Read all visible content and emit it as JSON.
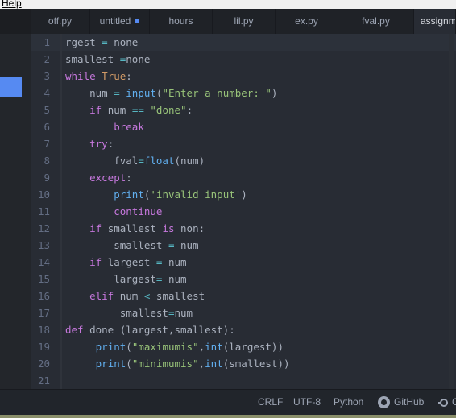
{
  "menu": {
    "help_label": "Help"
  },
  "tabs": [
    {
      "label": "off.py",
      "modified": false
    },
    {
      "label": "untitled",
      "modified": true
    },
    {
      "label": "hours",
      "modified": false
    },
    {
      "label": "lil.py",
      "modified": false
    },
    {
      "label": "ex.py",
      "modified": false
    },
    {
      "label": "fval.py",
      "modified": false
    },
    {
      "label": "assignm",
      "modified": false
    }
  ],
  "editor": {
    "lines": [
      {
        "n": "1",
        "code": "rgest = none"
      },
      {
        "n": "2",
        "code": "smallest =none"
      },
      {
        "n": "3",
        "code": "while True:"
      },
      {
        "n": "4",
        "code": "    num = input(\"Enter a number: \")"
      },
      {
        "n": "5",
        "code": "    if num == \"done\":"
      },
      {
        "n": "6",
        "code": "        break"
      },
      {
        "n": "7",
        "code": "    try:"
      },
      {
        "n": "8",
        "code": "        fval=float(num)"
      },
      {
        "n": "9",
        "code": "    except:"
      },
      {
        "n": "10",
        "code": "        print('invalid input')"
      },
      {
        "n": "11",
        "code": "        continue"
      },
      {
        "n": "12",
        "code": "    if smallest is non:"
      },
      {
        "n": "13",
        "code": "        smallest = num"
      },
      {
        "n": "14",
        "code": "    if largest = num"
      },
      {
        "n": "15",
        "code": "        largest= num"
      },
      {
        "n": "16",
        "code": "    elif num < smallest"
      },
      {
        "n": "17",
        "code": "         smallest=num"
      },
      {
        "n": "18",
        "code": "def done (largest,smallest):"
      },
      {
        "n": "19",
        "code": "     print(\"maximumis\",int(largest))"
      },
      {
        "n": "20",
        "code": "     print(\"minimumis\",int(smallest))"
      },
      {
        "n": "21",
        "code": ""
      }
    ]
  },
  "status": {
    "line_ending": "CRLF",
    "encoding": "UTF-8",
    "grammar": "Python",
    "github": "GitHub",
    "git_label": "G"
  }
}
